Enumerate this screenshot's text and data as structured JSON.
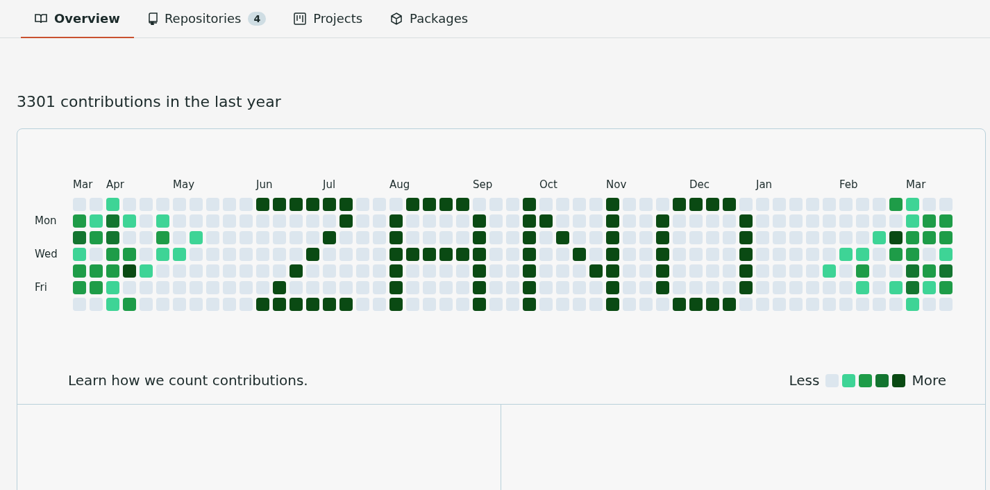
{
  "tabs": [
    {
      "label": "Overview",
      "selected": true
    },
    {
      "label": "Repositories",
      "counter": "4",
      "selected": false
    },
    {
      "label": "Projects",
      "selected": false
    },
    {
      "label": "Packages",
      "selected": false
    }
  ],
  "heading": "3301 contributions in the last year",
  "graph": {
    "day_labels": [
      "Mon",
      "Wed",
      "Fri"
    ],
    "weeks": [
      {
        "month": "Mar",
        "days": [
          {
            "color": "#dce6ee"
          },
          {
            "color": "#1e9c48"
          },
          {
            "color": "#137530"
          },
          {
            "color": "#3ed496"
          },
          {
            "color": "#1e9c48"
          },
          {
            "color": "#1e9c48"
          },
          {
            "color": "#dce6ee"
          }
        ]
      },
      {
        "days": [
          {
            "color": "#dce6ee"
          },
          {
            "color": "#3ed496"
          },
          {
            "color": "#1e9c48"
          },
          {
            "color": "#dce6ee"
          },
          {
            "color": "#1e9c48"
          },
          {
            "color": "#1e9c48"
          },
          {
            "color": "#dce6ee"
          }
        ]
      },
      {
        "month": "Apr",
        "days": [
          {
            "color": "#3ed496"
          },
          {
            "color": "#137530"
          },
          {
            "color": "#137530"
          },
          {
            "color": "#1e9c48"
          },
          {
            "color": "#1e9c48"
          },
          {
            "color": "#3ed496"
          },
          {
            "color": "#3ed496"
          }
        ]
      },
      {
        "days": [
          {
            "color": "#dce6ee"
          },
          {
            "color": "#3ed496"
          },
          {
            "color": "#dce6ee"
          },
          {
            "color": "#1e9c48"
          },
          {
            "color": "#0a4a13"
          },
          {
            "color": "#dce6ee"
          },
          {
            "color": "#1e9c48"
          }
        ]
      },
      {
        "days": [
          {
            "color": "#dce6ee"
          },
          {
            "color": "#dce6ee"
          },
          {
            "color": "#dce6ee"
          },
          {
            "color": "#dce6ee"
          },
          {
            "color": "#3ed496"
          },
          {
            "color": "#dce6ee"
          },
          {
            "color": "#dce6ee"
          }
        ]
      },
      {
        "days": [
          {
            "color": "#dce6ee"
          },
          {
            "color": "#3ed496"
          },
          {
            "color": "#1e9c48"
          },
          {
            "color": "#3ed496"
          },
          {
            "color": "#dce6ee"
          },
          {
            "color": "#dce6ee"
          },
          {
            "color": "#dce6ee"
          }
        ]
      },
      {
        "month": "May",
        "days": [
          {
            "color": "#dce6ee"
          },
          {
            "color": "#dce6ee"
          },
          {
            "color": "#dce6ee"
          },
          {
            "color": "#3ed496"
          },
          {
            "color": "#dce6ee"
          },
          {
            "color": "#dce6ee"
          },
          {
            "color": "#dce6ee"
          }
        ]
      },
      {
        "days": [
          {
            "color": "#dce6ee"
          },
          {
            "color": "#dce6ee"
          },
          {
            "color": "#3ed496"
          },
          {
            "color": "#dce6ee"
          },
          {
            "color": "#dce6ee"
          },
          {
            "color": "#dce6ee"
          },
          {
            "color": "#dce6ee"
          }
        ]
      },
      {
        "days": [
          {
            "color": "#dce6ee"
          },
          {
            "color": "#dce6ee"
          },
          {
            "color": "#dce6ee"
          },
          {
            "color": "#dce6ee"
          },
          {
            "color": "#dce6ee"
          },
          {
            "color": "#dce6ee"
          },
          {
            "color": "#dce6ee"
          }
        ]
      },
      {
        "days": [
          {
            "color": "#dce6ee"
          },
          {
            "color": "#dce6ee"
          },
          {
            "color": "#dce6ee"
          },
          {
            "color": "#dce6ee"
          },
          {
            "color": "#dce6ee"
          },
          {
            "color": "#dce6ee"
          },
          {
            "color": "#dce6ee"
          }
        ]
      },
      {
        "days": [
          {
            "color": "#dce6ee"
          },
          {
            "color": "#dce6ee"
          },
          {
            "color": "#dce6ee"
          },
          {
            "color": "#dce6ee"
          },
          {
            "color": "#dce6ee"
          },
          {
            "color": "#dce6ee"
          },
          {
            "color": "#dce6ee"
          }
        ]
      },
      {
        "month": "Jun",
        "days": [
          {
            "color": "#0a4a13"
          },
          {
            "color": "#dce6ee"
          },
          {
            "color": "#dce6ee"
          },
          {
            "color": "#dce6ee"
          },
          {
            "color": "#dce6ee"
          },
          {
            "color": "#dce6ee"
          },
          {
            "color": "#0a4a13"
          }
        ]
      },
      {
        "days": [
          {
            "color": "#0a4a13"
          },
          {
            "color": "#dce6ee"
          },
          {
            "color": "#dce6ee"
          },
          {
            "color": "#dce6ee"
          },
          {
            "color": "#dce6ee"
          },
          {
            "color": "#0a4a13"
          },
          {
            "color": "#0a4a13"
          }
        ]
      },
      {
        "days": [
          {
            "color": "#0a4a13"
          },
          {
            "color": "#dce6ee"
          },
          {
            "color": "#dce6ee"
          },
          {
            "color": "#dce6ee"
          },
          {
            "color": "#0a4a13"
          },
          {
            "color": "#dce6ee"
          },
          {
            "color": "#0a4a13"
          }
        ]
      },
      {
        "days": [
          {
            "color": "#0a4a13"
          },
          {
            "color": "#dce6ee"
          },
          {
            "color": "#dce6ee"
          },
          {
            "color": "#0a4a13"
          },
          {
            "color": "#dce6ee"
          },
          {
            "color": "#dce6ee"
          },
          {
            "color": "#0a4a13"
          }
        ]
      },
      {
        "month": "Jul",
        "days": [
          {
            "color": "#0a4a13"
          },
          {
            "color": "#dce6ee"
          },
          {
            "color": "#0a4a13"
          },
          {
            "color": "#dce6ee"
          },
          {
            "color": "#dce6ee"
          },
          {
            "color": "#dce6ee"
          },
          {
            "color": "#0a4a13"
          }
        ]
      },
      {
        "days": [
          {
            "color": "#0a4a13"
          },
          {
            "color": "#0a4a13"
          },
          {
            "color": "#dce6ee"
          },
          {
            "color": "#dce6ee"
          },
          {
            "color": "#dce6ee"
          },
          {
            "color": "#dce6ee"
          },
          {
            "color": "#0a4a13"
          }
        ]
      },
      {
        "days": [
          {
            "color": "#dce6ee"
          },
          {
            "color": "#dce6ee"
          },
          {
            "color": "#dce6ee"
          },
          {
            "color": "#dce6ee"
          },
          {
            "color": "#dce6ee"
          },
          {
            "color": "#dce6ee"
          },
          {
            "color": "#dce6ee"
          }
        ]
      },
      {
        "days": [
          {
            "color": "#dce6ee"
          },
          {
            "color": "#dce6ee"
          },
          {
            "color": "#dce6ee"
          },
          {
            "color": "#dce6ee"
          },
          {
            "color": "#dce6ee"
          },
          {
            "color": "#dce6ee"
          },
          {
            "color": "#dce6ee"
          }
        ]
      },
      {
        "month": "Aug",
        "days": [
          {
            "color": "#dce6ee"
          },
          {
            "color": "#0a4a13"
          },
          {
            "color": "#0a4a13"
          },
          {
            "color": "#0a4a13"
          },
          {
            "color": "#0a4a13"
          },
          {
            "color": "#0a4a13"
          },
          {
            "color": "#0a4a13"
          }
        ]
      },
      {
        "days": [
          {
            "color": "#0a4a13"
          },
          {
            "color": "#dce6ee"
          },
          {
            "color": "#dce6ee"
          },
          {
            "color": "#0a4a13"
          },
          {
            "color": "#dce6ee"
          },
          {
            "color": "#dce6ee"
          },
          {
            "color": "#dce6ee"
          }
        ]
      },
      {
        "days": [
          {
            "color": "#0a4a13"
          },
          {
            "color": "#dce6ee"
          },
          {
            "color": "#dce6ee"
          },
          {
            "color": "#0a4a13"
          },
          {
            "color": "#dce6ee"
          },
          {
            "color": "#dce6ee"
          },
          {
            "color": "#dce6ee"
          }
        ]
      },
      {
        "days": [
          {
            "color": "#0a4a13"
          },
          {
            "color": "#dce6ee"
          },
          {
            "color": "#dce6ee"
          },
          {
            "color": "#0a4a13"
          },
          {
            "color": "#dce6ee"
          },
          {
            "color": "#dce6ee"
          },
          {
            "color": "#dce6ee"
          }
        ]
      },
      {
        "days": [
          {
            "color": "#0a4a13"
          },
          {
            "color": "#dce6ee"
          },
          {
            "color": "#dce6ee"
          },
          {
            "color": "#0a4a13"
          },
          {
            "color": "#dce6ee"
          },
          {
            "color": "#dce6ee"
          },
          {
            "color": "#dce6ee"
          }
        ]
      },
      {
        "month": "Sep",
        "days": [
          {
            "color": "#dce6ee"
          },
          {
            "color": "#0a4a13"
          },
          {
            "color": "#0a4a13"
          },
          {
            "color": "#0a4a13"
          },
          {
            "color": "#0a4a13"
          },
          {
            "color": "#0a4a13"
          },
          {
            "color": "#0a4a13"
          }
        ]
      },
      {
        "days": [
          {
            "color": "#dce6ee"
          },
          {
            "color": "#dce6ee"
          },
          {
            "color": "#dce6ee"
          },
          {
            "color": "#dce6ee"
          },
          {
            "color": "#dce6ee"
          },
          {
            "color": "#dce6ee"
          },
          {
            "color": "#dce6ee"
          }
        ]
      },
      {
        "days": [
          {
            "color": "#dce6ee"
          },
          {
            "color": "#dce6ee"
          },
          {
            "color": "#dce6ee"
          },
          {
            "color": "#dce6ee"
          },
          {
            "color": "#dce6ee"
          },
          {
            "color": "#dce6ee"
          },
          {
            "color": "#dce6ee"
          }
        ]
      },
      {
        "days": [
          {
            "color": "#0a4a13"
          },
          {
            "color": "#0a4a13"
          },
          {
            "color": "#0a4a13"
          },
          {
            "color": "#0a4a13"
          },
          {
            "color": "#0a4a13"
          },
          {
            "color": "#0a4a13"
          },
          {
            "color": "#0a4a13"
          }
        ]
      },
      {
        "month": "Oct",
        "days": [
          {
            "color": "#dce6ee"
          },
          {
            "color": "#0a4a13"
          },
          {
            "color": "#dce6ee"
          },
          {
            "color": "#dce6ee"
          },
          {
            "color": "#dce6ee"
          },
          {
            "color": "#dce6ee"
          },
          {
            "color": "#dce6ee"
          }
        ]
      },
      {
        "days": [
          {
            "color": "#dce6ee"
          },
          {
            "color": "#dce6ee"
          },
          {
            "color": "#0a4a13"
          },
          {
            "color": "#dce6ee"
          },
          {
            "color": "#dce6ee"
          },
          {
            "color": "#dce6ee"
          },
          {
            "color": "#dce6ee"
          }
        ]
      },
      {
        "days": [
          {
            "color": "#dce6ee"
          },
          {
            "color": "#dce6ee"
          },
          {
            "color": "#dce6ee"
          },
          {
            "color": "#0a4a13"
          },
          {
            "color": "#dce6ee"
          },
          {
            "color": "#dce6ee"
          },
          {
            "color": "#dce6ee"
          }
        ]
      },
      {
        "days": [
          {
            "color": "#dce6ee"
          },
          {
            "color": "#dce6ee"
          },
          {
            "color": "#dce6ee"
          },
          {
            "color": "#dce6ee"
          },
          {
            "color": "#0a4a13"
          },
          {
            "color": "#dce6ee"
          },
          {
            "color": "#dce6ee"
          }
        ]
      },
      {
        "month": "Nov",
        "days": [
          {
            "color": "#0a4a13"
          },
          {
            "color": "#0a4a13"
          },
          {
            "color": "#0a4a13"
          },
          {
            "color": "#0a4a13"
          },
          {
            "color": "#0a4a13"
          },
          {
            "color": "#0a4a13"
          },
          {
            "color": "#0a4a13"
          }
        ]
      },
      {
        "days": [
          {
            "color": "#dce6ee"
          },
          {
            "color": "#dce6ee"
          },
          {
            "color": "#dce6ee"
          },
          {
            "color": "#dce6ee"
          },
          {
            "color": "#dce6ee"
          },
          {
            "color": "#dce6ee"
          },
          {
            "color": "#dce6ee"
          }
        ]
      },
      {
        "days": [
          {
            "color": "#dce6ee"
          },
          {
            "color": "#dce6ee"
          },
          {
            "color": "#dce6ee"
          },
          {
            "color": "#dce6ee"
          },
          {
            "color": "#dce6ee"
          },
          {
            "color": "#dce6ee"
          },
          {
            "color": "#dce6ee"
          }
        ]
      },
      {
        "days": [
          {
            "color": "#dce6ee"
          },
          {
            "color": "#0a4a13"
          },
          {
            "color": "#0a4a13"
          },
          {
            "color": "#0a4a13"
          },
          {
            "color": "#0a4a13"
          },
          {
            "color": "#0a4a13"
          },
          {
            "color": "#dce6ee"
          }
        ]
      },
      {
        "days": [
          {
            "color": "#0a4a13"
          },
          {
            "color": "#dce6ee"
          },
          {
            "color": "#dce6ee"
          },
          {
            "color": "#dce6ee"
          },
          {
            "color": "#dce6ee"
          },
          {
            "color": "#dce6ee"
          },
          {
            "color": "#0a4a13"
          }
        ]
      },
      {
        "month": "Dec",
        "days": [
          {
            "color": "#0a4a13"
          },
          {
            "color": "#dce6ee"
          },
          {
            "color": "#dce6ee"
          },
          {
            "color": "#dce6ee"
          },
          {
            "color": "#dce6ee"
          },
          {
            "color": "#dce6ee"
          },
          {
            "color": "#0a4a13"
          }
        ]
      },
      {
        "days": [
          {
            "color": "#0a4a13"
          },
          {
            "color": "#dce6ee"
          },
          {
            "color": "#dce6ee"
          },
          {
            "color": "#dce6ee"
          },
          {
            "color": "#dce6ee"
          },
          {
            "color": "#dce6ee"
          },
          {
            "color": "#0a4a13"
          }
        ]
      },
      {
        "days": [
          {
            "color": "#0a4a13"
          },
          {
            "color": "#dce6ee"
          },
          {
            "color": "#dce6ee"
          },
          {
            "color": "#dce6ee"
          },
          {
            "color": "#dce6ee"
          },
          {
            "color": "#dce6ee"
          },
          {
            "color": "#0a4a13"
          }
        ]
      },
      {
        "days": [
          {
            "color": "#dce6ee"
          },
          {
            "color": "#0a4a13"
          },
          {
            "color": "#0a4a13"
          },
          {
            "color": "#0a4a13"
          },
          {
            "color": "#0a4a13"
          },
          {
            "color": "#0a4a13"
          },
          {
            "color": "#dce6ee"
          }
        ]
      },
      {
        "month": "Jan",
        "days": [
          {
            "color": "#dce6ee"
          },
          {
            "color": "#dce6ee"
          },
          {
            "color": "#dce6ee"
          },
          {
            "color": "#dce6ee"
          },
          {
            "color": "#dce6ee"
          },
          {
            "color": "#dce6ee"
          },
          {
            "color": "#dce6ee"
          }
        ]
      },
      {
        "days": [
          {
            "color": "#dce6ee"
          },
          {
            "color": "#dce6ee"
          },
          {
            "color": "#dce6ee"
          },
          {
            "color": "#dce6ee"
          },
          {
            "color": "#dce6ee"
          },
          {
            "color": "#dce6ee"
          },
          {
            "color": "#dce6ee"
          }
        ]
      },
      {
        "days": [
          {
            "color": "#dce6ee"
          },
          {
            "color": "#dce6ee"
          },
          {
            "color": "#dce6ee"
          },
          {
            "color": "#dce6ee"
          },
          {
            "color": "#dce6ee"
          },
          {
            "color": "#dce6ee"
          },
          {
            "color": "#dce6ee"
          }
        ]
      },
      {
        "days": [
          {
            "color": "#dce6ee"
          },
          {
            "color": "#dce6ee"
          },
          {
            "color": "#dce6ee"
          },
          {
            "color": "#dce6ee"
          },
          {
            "color": "#dce6ee"
          },
          {
            "color": "#dce6ee"
          },
          {
            "color": "#dce6ee"
          }
        ]
      },
      {
        "days": [
          {
            "color": "#dce6ee"
          },
          {
            "color": "#dce6ee"
          },
          {
            "color": "#dce6ee"
          },
          {
            "color": "#dce6ee"
          },
          {
            "color": "#3ed496"
          },
          {
            "color": "#dce6ee"
          },
          {
            "color": "#dce6ee"
          }
        ]
      },
      {
        "month": "Feb",
        "days": [
          {
            "color": "#dce6ee"
          },
          {
            "color": "#dce6ee"
          },
          {
            "color": "#dce6ee"
          },
          {
            "color": "#3ed496"
          },
          {
            "color": "#dce6ee"
          },
          {
            "color": "#dce6ee"
          },
          {
            "color": "#dce6ee"
          }
        ]
      },
      {
        "days": [
          {
            "color": "#dce6ee"
          },
          {
            "color": "#dce6ee"
          },
          {
            "color": "#dce6ee"
          },
          {
            "color": "#3ed496"
          },
          {
            "color": "#1e9c48"
          },
          {
            "color": "#3ed496"
          },
          {
            "color": "#dce6ee"
          }
        ]
      },
      {
        "days": [
          {
            "color": "#dce6ee"
          },
          {
            "color": "#dce6ee"
          },
          {
            "color": "#3ed496"
          },
          {
            "color": "#dce6ee"
          },
          {
            "color": "#dce6ee"
          },
          {
            "color": "#dce6ee"
          },
          {
            "color": "#dce6ee"
          }
        ]
      },
      {
        "days": [
          {
            "color": "#1e9c48"
          },
          {
            "color": "#dce6ee"
          },
          {
            "color": "#0a4a13"
          },
          {
            "color": "#1e9c48"
          },
          {
            "color": "#dce6ee"
          },
          {
            "color": "#3ed496"
          },
          {
            "color": "#dce6ee"
          }
        ]
      },
      {
        "month": "Mar",
        "days": [
          {
            "color": "#3ed496"
          },
          {
            "color": "#3ed496"
          },
          {
            "color": "#1e9c48"
          },
          {
            "color": "#1e9c48"
          },
          {
            "color": "#137530"
          },
          {
            "color": "#137530"
          },
          {
            "color": "#3ed496"
          }
        ]
      },
      {
        "days": [
          {
            "color": "#dce6ee"
          },
          {
            "color": "#1e9c48"
          },
          {
            "color": "#1e9c48"
          },
          {
            "color": "#dce6ee"
          },
          {
            "color": "#1e9c48"
          },
          {
            "color": "#3ed496"
          },
          {
            "color": "#dce6ee"
          }
        ]
      },
      {
        "days": [
          {
            "color": "#dce6ee"
          },
          {
            "color": "#1e9c48"
          },
          {
            "color": "#1e9c48"
          },
          {
            "color": "#3ed496"
          },
          {
            "color": "#137530"
          },
          {
            "color": "#1e9c48"
          },
          {
            "color": "#dce6ee"
          }
        ]
      }
    ],
    "footer_link": "Learn how we count contributions.",
    "legend": {
      "less": "Less",
      "more": "More",
      "swatches": [
        {
          "color": "#dce6ee"
        },
        {
          "color": "#3ed496"
        },
        {
          "color": "#1e9c48"
        },
        {
          "color": "#137530"
        },
        {
          "color": "#0a4a13"
        }
      ]
    }
  }
}
